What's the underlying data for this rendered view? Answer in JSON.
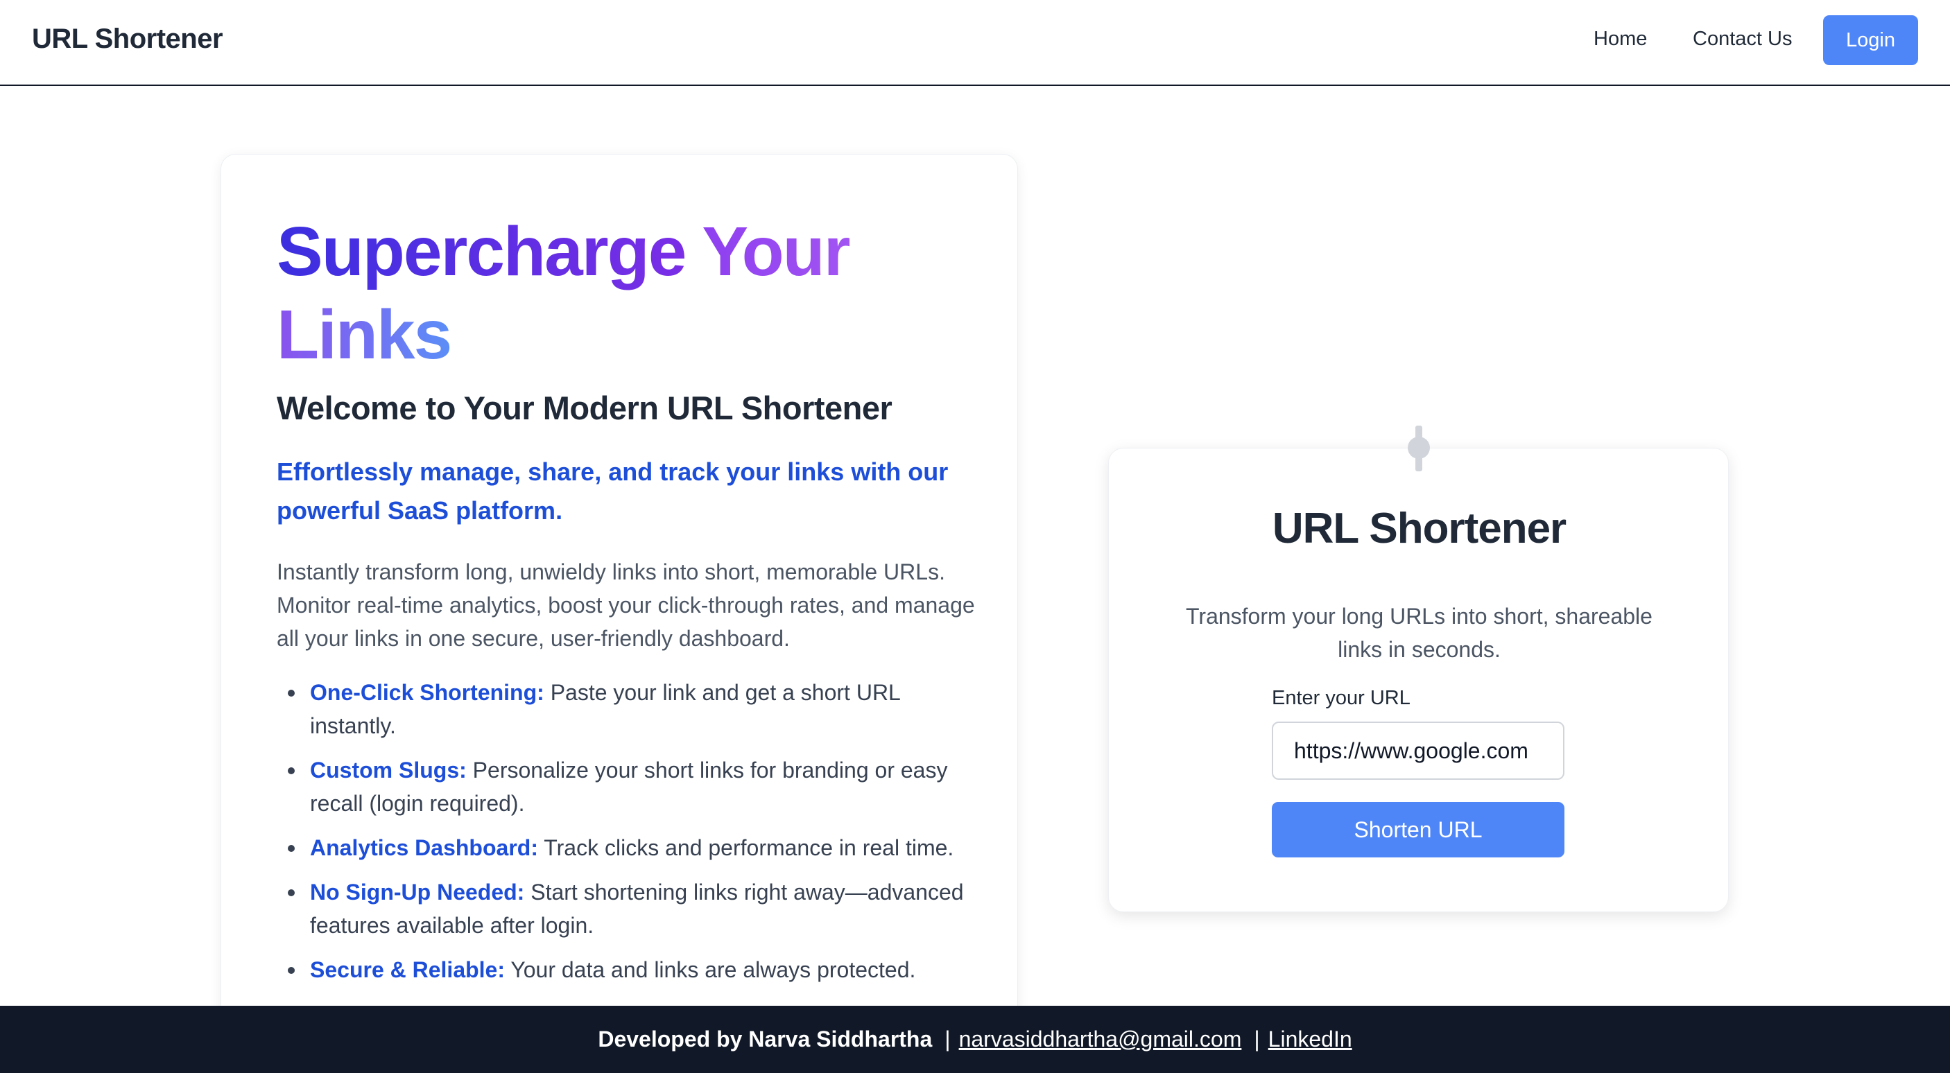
{
  "header": {
    "brand": "URL Shortener",
    "nav": {
      "home": "Home",
      "contact": "Contact Us"
    },
    "login_label": "Login"
  },
  "hero": {
    "title_word1": "Supercharge",
    "title_word2": "Your",
    "title_word3": "Links",
    "welcome": "Welcome to Your Modern URL Shortener",
    "tagline": "Effortlessly manage, share, and track your links with our powerful SaaS platform.",
    "intro": "Instantly transform long, unwieldy links into short, memorable URLs. Monitor real-time analytics, boost your click-through rates, and manage all your links in one secure, user-friendly dashboard.",
    "features": [
      {
        "title": "One-Click Shortening:",
        "text": " Paste your link and get a short URL instantly."
      },
      {
        "title": "Custom Slugs:",
        "text": " Personalize your short links for branding or easy recall (login required)."
      },
      {
        "title": "Analytics Dashboard:",
        "text": " Track clicks and performance in real time."
      },
      {
        "title": "No Sign-Up Needed:",
        "text": " Start shortening links right away—advanced features available after login."
      },
      {
        "title": "Secure & Reliable:",
        "text": " Your data and links are always protected."
      }
    ]
  },
  "shortener": {
    "title": "URL Shortener",
    "subtitle": "Transform your long URLs into short, shareable links in seconds.",
    "input_label": "Enter your URL",
    "input_value": "https://www.google.com",
    "button_label": "Shorten URL"
  },
  "footer": {
    "developer": "Developed by Narva Siddhartha",
    "separator": "|",
    "email": "narvasiddhartha@gmail.com",
    "linkedin": "LinkedIn"
  },
  "colors": {
    "accent": "#4f86f7",
    "link_blue": "#1d4ed8",
    "footer_bg": "#111827"
  }
}
